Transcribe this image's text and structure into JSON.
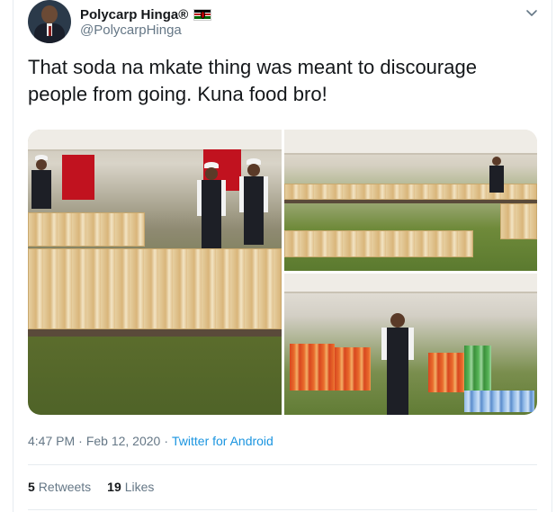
{
  "user": {
    "name": "Polycarp Hinga®",
    "handle": "@PolycarpHinga"
  },
  "tweet": {
    "text": "That soda na mkate thing was meant to discourage people from going. Kuna food bro!",
    "time": "4:47 PM",
    "separator": "·",
    "date": "Feb 12, 2020",
    "source": "Twitter for Android"
  },
  "stats": {
    "retweets_count": "5",
    "retweets_label": "Retweets",
    "likes_count": "19",
    "likes_label": "Likes"
  },
  "icons": {
    "flag": "kenya-flag-icon",
    "menu": "chevron-down-icon"
  },
  "colors": {
    "link": "#1b95e0",
    "secondary_text": "#657786",
    "primary_text": "#14171a",
    "border": "#e6ecf0"
  }
}
